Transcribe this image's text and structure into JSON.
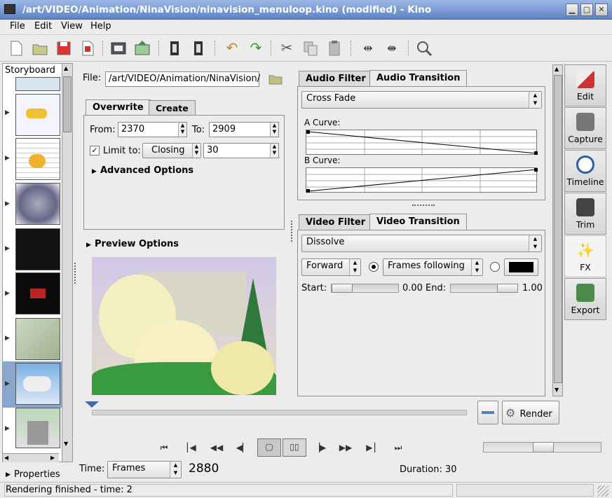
{
  "window": {
    "title": "/art/VIDEO/Animation/NinaVision/ninavision_menuloop.kino (modified)  - Kino"
  },
  "menu": [
    "File",
    "Edit",
    "View",
    "Help"
  ],
  "storyboard": {
    "label": "Storyboard",
    "properties_label": "Properties"
  },
  "file_row": {
    "label": "File:",
    "value": "/art/VIDEO/Animation/NinaVision/"
  },
  "left_tabs": {
    "overwrite": "Overwrite",
    "create": "Create"
  },
  "range": {
    "from_label": "From:",
    "from_value": "2370",
    "to_label": "To:",
    "to_value": "2909"
  },
  "limit": {
    "label": "Limit to:",
    "mode": "Closing",
    "value": "30"
  },
  "advanced": "Advanced Options",
  "preview": "Preview Options",
  "audio": {
    "tab_filter": "Audio Filter",
    "tab_transition": "Audio Transition",
    "transition": "Cross Fade",
    "a_curve": "A Curve:",
    "b_curve": "B Curve:"
  },
  "video": {
    "tab_filter": "Video Filter",
    "tab_transition": "Video Transition",
    "transition": "Dissolve",
    "direction": "Forward",
    "frames": "Frames following",
    "color": "#000000",
    "start_label": "Start:",
    "start_value": "0.00",
    "end_label": "End:",
    "end_value": "1.00"
  },
  "render_label": "Render",
  "side_buttons": [
    "Edit",
    "Capture",
    "Timeline",
    "Trim",
    "FX",
    "Export"
  ],
  "bottom": {
    "time_label": "Time:",
    "time_mode": "Frames",
    "frame": "2880",
    "duration": "Duration: 30"
  },
  "status": "Rendering finished - time: 2"
}
